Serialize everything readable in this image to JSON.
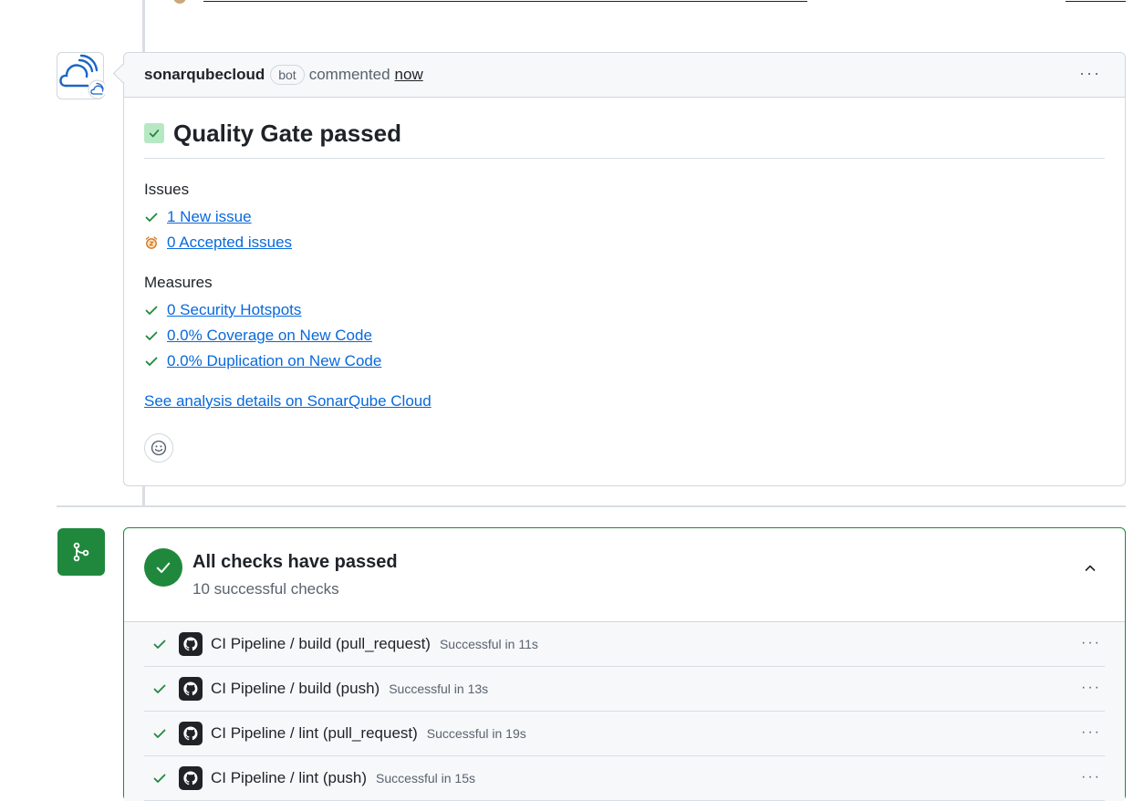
{
  "comment": {
    "author": "sonarqubecloud",
    "badge": "bot",
    "action": "commented",
    "time": "now",
    "more_label": "···",
    "title": "Quality Gate passed",
    "issues_label": "Issues",
    "issues": [
      {
        "text": "1 New issue",
        "icon": "check-icon"
      },
      {
        "text": "0 Accepted issues",
        "icon": "alarm-clock-icon"
      }
    ],
    "measures_label": "Measures",
    "measures": [
      {
        "text": "0 Security Hotspots",
        "icon": "check-icon"
      },
      {
        "text": "0.0% Coverage on New Code",
        "icon": "check-icon"
      },
      {
        "text": "0.0% Duplication on New Code",
        "icon": "check-icon"
      }
    ],
    "details_link": "See analysis details on SonarQube Cloud",
    "reaction_icon": "smiley-icon"
  },
  "checks": {
    "title": "All checks have passed",
    "subtitle": "10 successful checks",
    "rows": [
      {
        "name": "CI Pipeline / build (pull_request)",
        "status": "Successful in 11s"
      },
      {
        "name": "CI Pipeline / build (push)",
        "status": "Successful in 13s"
      },
      {
        "name": "CI Pipeline / lint (pull_request)",
        "status": "Successful in 19s"
      },
      {
        "name": "CI Pipeline / lint (push)",
        "status": "Successful in 15s"
      }
    ],
    "row_more_label": "···"
  },
  "colors": {
    "success": "#1f883d",
    "link": "#0969da",
    "border": "#d0d7de"
  }
}
